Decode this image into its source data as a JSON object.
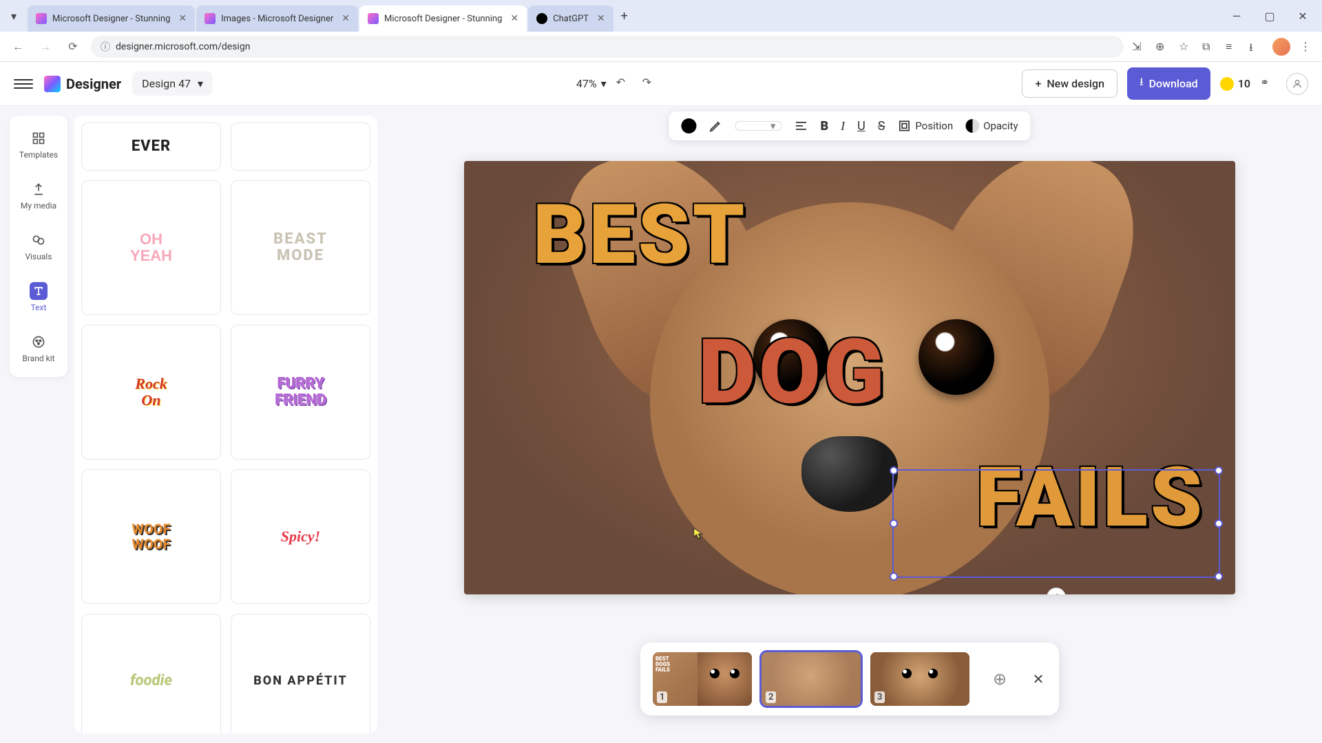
{
  "browser": {
    "tabs": [
      {
        "title": "Microsoft Designer - Stunning",
        "favicon": "designer",
        "active": false
      },
      {
        "title": "Images - Microsoft Designer",
        "favicon": "designer",
        "active": false
      },
      {
        "title": "Microsoft Designer - Stunning",
        "favicon": "designer",
        "active": true
      },
      {
        "title": "ChatGPT",
        "favicon": "chatgpt",
        "active": false
      }
    ],
    "url": "designer.microsoft.com/design"
  },
  "header": {
    "app_name": "Designer",
    "design_name": "Design 47",
    "zoom": "47%",
    "new_design_label": "New design",
    "download_label": "Download",
    "credits": "10"
  },
  "rail": {
    "items": [
      {
        "label": "Templates",
        "active": false
      },
      {
        "label": "My media",
        "active": false
      },
      {
        "label": "Visuals",
        "active": false
      },
      {
        "label": "Text",
        "active": true
      },
      {
        "label": "Brand kit",
        "active": false
      }
    ]
  },
  "text_styles": [
    {
      "label": "EVER",
      "class": "tc-ever half"
    },
    {
      "label": "",
      "class": "tc-blank half"
    },
    {
      "label": "OH\nYEAH",
      "class": "tc-ohyeah"
    },
    {
      "label": "BEAST\nMODE",
      "class": "tc-beast"
    },
    {
      "label": "Rock\nOn",
      "class": "tc-rock"
    },
    {
      "label": "FURRY\nFRIEND",
      "class": "tc-furry"
    },
    {
      "label": "WOOF\nWOOF",
      "class": "tc-woof"
    },
    {
      "label": "Spicy!",
      "class": "tc-spicy"
    },
    {
      "label": "foodie",
      "class": "tc-foodie"
    },
    {
      "label": "BON APPÉTIT",
      "class": "tc-bon"
    }
  ],
  "toolbar": {
    "position_label": "Position",
    "opacity_label": "Opacity"
  },
  "canvas": {
    "text_best": "BEST",
    "text_dog": "DOG",
    "text_fails": "FAILS",
    "selected": "fails"
  },
  "pages": {
    "items": [
      {
        "num": "1",
        "active": false
      },
      {
        "num": "2",
        "active": true
      },
      {
        "num": "3",
        "active": false
      }
    ]
  }
}
